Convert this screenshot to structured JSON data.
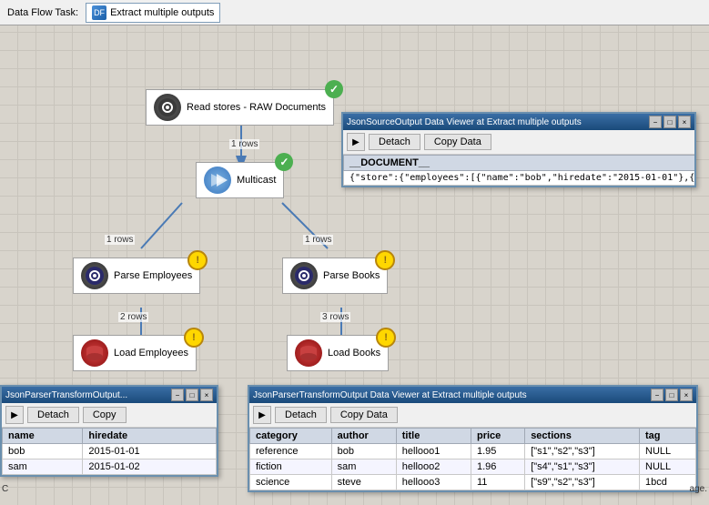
{
  "topbar": {
    "label": "Data Flow Task:",
    "task_icon": "DF",
    "task_name": "Extract multiple outputs"
  },
  "nodes": {
    "read_stores": {
      "label": "Read stores - RAW Documents",
      "icon_color": "#4a4a4a"
    },
    "multicast": {
      "label": "Multicast"
    },
    "parse_employees": {
      "label": "Parse Employees"
    },
    "parse_books": {
      "label": "Parse Books"
    },
    "load_employees": {
      "label": "Load Employees"
    },
    "load_books": {
      "label": "Load Books"
    }
  },
  "row_counts": {
    "read_to_multi": "1 rows",
    "multi_to_emp": "1 rows",
    "multi_to_books": "1 rows",
    "emp_to_load": "2 rows",
    "books_to_load": "3 rows"
  },
  "json_viewer": {
    "title": "JsonSourceOutput Data Viewer at Extract multiple outputs",
    "detach_label": "Detach",
    "copy_label": "Copy Data",
    "column_header": "__DOCUMENT__",
    "row_value": "{\"store\":{\"employees\":[{\"name\":\"bob\",\"hiredate\":\"2015-01-01\"},{\"name\":\"sam\","
  },
  "emp_viewer": {
    "title": "JsonParserTransformOutput...",
    "detach_label": "Detach",
    "copy_label": "Copy",
    "columns": [
      "name",
      "hiredate"
    ],
    "rows": [
      [
        "bob",
        "2015-01-01"
      ],
      [
        "sam",
        "2015-01-02"
      ]
    ]
  },
  "books_viewer": {
    "title": "JsonParserTransformOutput Data Viewer at Extract multiple outputs",
    "detach_label": "Detach",
    "copy_label": "Copy Data",
    "columns": [
      "category",
      "author",
      "title",
      "price",
      "sections",
      "tag"
    ],
    "rows": [
      [
        "reference",
        "bob",
        "hellooo1",
        "1.95",
        "[\"s1\",\"s2\",\"s3\"]",
        "NULL"
      ],
      [
        "fiction",
        "sam",
        "hellooo2",
        "1.96",
        "[\"s4\",\"s1\",\"s3\"]",
        "NULL"
      ],
      [
        "science",
        "steve",
        "hellooo3",
        "11",
        "[\"s9\",\"s2\",\"s3\"]",
        "1bcd"
      ]
    ]
  },
  "controls": {
    "minimize": "−",
    "restore": "□",
    "close": "×"
  }
}
